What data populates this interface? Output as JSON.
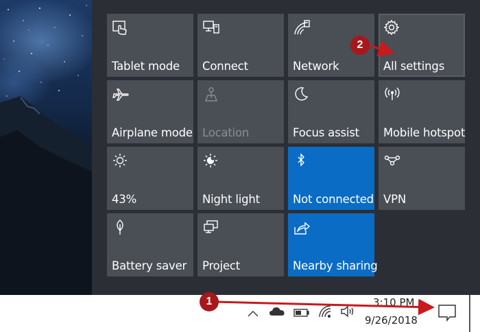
{
  "quick_actions": {
    "tiles": [
      {
        "label": "Tablet mode",
        "icon": "tablet-mode-icon"
      },
      {
        "label": "Connect",
        "icon": "connect-icon"
      },
      {
        "label": "Network",
        "icon": "network-icon"
      },
      {
        "label": "All settings",
        "icon": "gear-icon"
      },
      {
        "label": "Airplane mode",
        "icon": "airplane-icon"
      },
      {
        "label": "Location",
        "icon": "location-icon",
        "state": "disabled"
      },
      {
        "label": "Focus assist",
        "icon": "moon-icon"
      },
      {
        "label": "Mobile hotspot",
        "icon": "hotspot-icon"
      },
      {
        "label": "43%",
        "icon": "brightness-icon"
      },
      {
        "label": "Night light",
        "icon": "night-light-icon"
      },
      {
        "label": "Not connected",
        "icon": "bluetooth-icon",
        "state": "active"
      },
      {
        "label": "VPN",
        "icon": "vpn-icon"
      },
      {
        "label": "Battery saver",
        "icon": "battery-saver-icon"
      },
      {
        "label": "Project",
        "icon": "project-icon"
      },
      {
        "label": "Nearby sharing",
        "icon": "nearby-sharing-icon",
        "state": "active"
      }
    ]
  },
  "taskbar": {
    "time": "3:10 PM",
    "date": "9/26/2018",
    "tray_icons": [
      "chevron-up-icon",
      "onedrive-cloud-icon",
      "battery-icon",
      "wifi-icon",
      "volume-icon",
      "action-center-icon"
    ]
  },
  "annotations": {
    "step1": "1",
    "step2": "2",
    "color": "#a8171b"
  },
  "colors": {
    "tile": "#4a4e55",
    "tile_active": "#0a6cc4",
    "panel": "#2b2f35"
  }
}
